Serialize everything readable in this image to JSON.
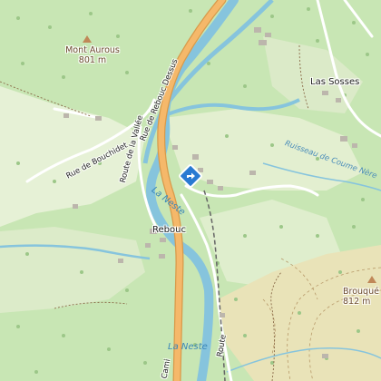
{
  "map": {
    "peaks": [
      {
        "name": "Mont Aurous",
        "elevation": "801 m"
      },
      {
        "name": "Brouqué",
        "elevation": "812 m"
      }
    ],
    "places": [
      "Las Sosses",
      "Rebouc"
    ],
    "rivers": [
      "La Neste",
      "La Neste"
    ],
    "streams": [
      "Ruisseau de Coume Nère"
    ],
    "roads": [
      "Route de la Vallée",
      "Rue de Rebouc Dessus",
      "Rue de Bouchidet",
      "Route",
      "Cami"
    ],
    "poi": {
      "icon": "directions-diamond-icon",
      "color": "#2a7ad2"
    },
    "colors": {
      "forest": "#c8e6b4",
      "meadow": "#e7f1d8",
      "highland": "#e9e3b8",
      "water": "#86c4dd",
      "main_road": "#f5b86a",
      "contour": "#b89a6a",
      "building": "#bcb6ac"
    }
  }
}
